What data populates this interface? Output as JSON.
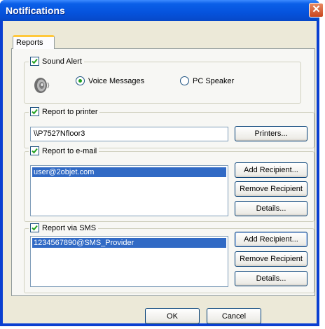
{
  "window": {
    "title": "Notifications",
    "close_glyph": "✕"
  },
  "tabs": [
    {
      "label": "Reports"
    }
  ],
  "sound_alert": {
    "label": "Sound Alert",
    "checked": true,
    "icon": "speaker-icon",
    "voice_messages_label": "Voice Messages",
    "pc_speaker_label": "PC Speaker",
    "selected": "Voice Messages"
  },
  "printer": {
    "label": "Report to printer",
    "checked": true,
    "path_value": "\\\\P7527Nfloor3",
    "printers_button": "Printers..."
  },
  "email": {
    "label": "Report to e-mail",
    "checked": true,
    "recipients": [
      "user@2objet.com"
    ],
    "add_button": "Add Recipient...",
    "remove_button": "Remove Recipient",
    "details_button": "Details..."
  },
  "sms": {
    "label": "Report via SMS",
    "checked": true,
    "recipients": [
      "1234567890@SMS_Provider"
    ],
    "add_button": "Add Recipient...",
    "remove_button": "Remove Recipient",
    "details_button": "Details..."
  },
  "footer": {
    "ok_button": "OK",
    "cancel_button": "Cancel"
  },
  "colors": {
    "title_bar": "#0553dd",
    "selection": "#316ac5",
    "face": "#ece9d8"
  }
}
